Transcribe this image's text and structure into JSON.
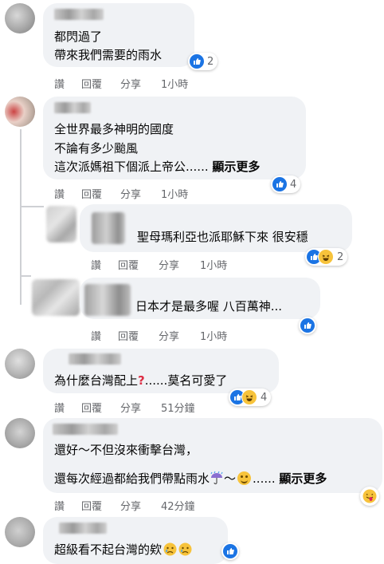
{
  "actions": {
    "like": "讚",
    "reply": "回覆",
    "share": "分享"
  },
  "comments": [
    {
      "lines": [
        "都閃過了",
        "帶來我們需要的雨水"
      ],
      "reaction_count": "2",
      "time": "1小時"
    },
    {
      "lines": [
        "全世界最多神明的國度",
        "不論有多少颱風",
        "這次派媽祖下個派上帝公......"
      ],
      "see_more": "顯示更多",
      "reaction_count": "4",
      "time": "1小時",
      "replies": [
        {
          "text": "聖母瑪利亞也派耶穌下來 很安穩",
          "reaction_count": "2",
          "time": "1小時"
        },
        {
          "text": "日本才是最多喔 八百萬神...",
          "time": "1小時"
        }
      ]
    },
    {
      "text_before": "為什麼台灣配上",
      "icon": "question-mark-icon",
      "text_after": "......莫名可愛了",
      "reaction_count": "4",
      "time": "51分鐘"
    },
    {
      "lines": [
        "還好～不但沒來衝擊台灣，"
      ],
      "line2_before": "還每次經過都給我們帶點雨水",
      "line2_mid": "～",
      "line2_after": "......",
      "see_more": "顯示更多",
      "time": "42分鐘"
    },
    {
      "text": "超級看不起台灣的欸"
    }
  ],
  "colors": {
    "bubble": "#f0f2f5",
    "like_blue": "#1b74e4",
    "meta_gray": "#65676b",
    "haha_yellow": "#f7c33b"
  }
}
